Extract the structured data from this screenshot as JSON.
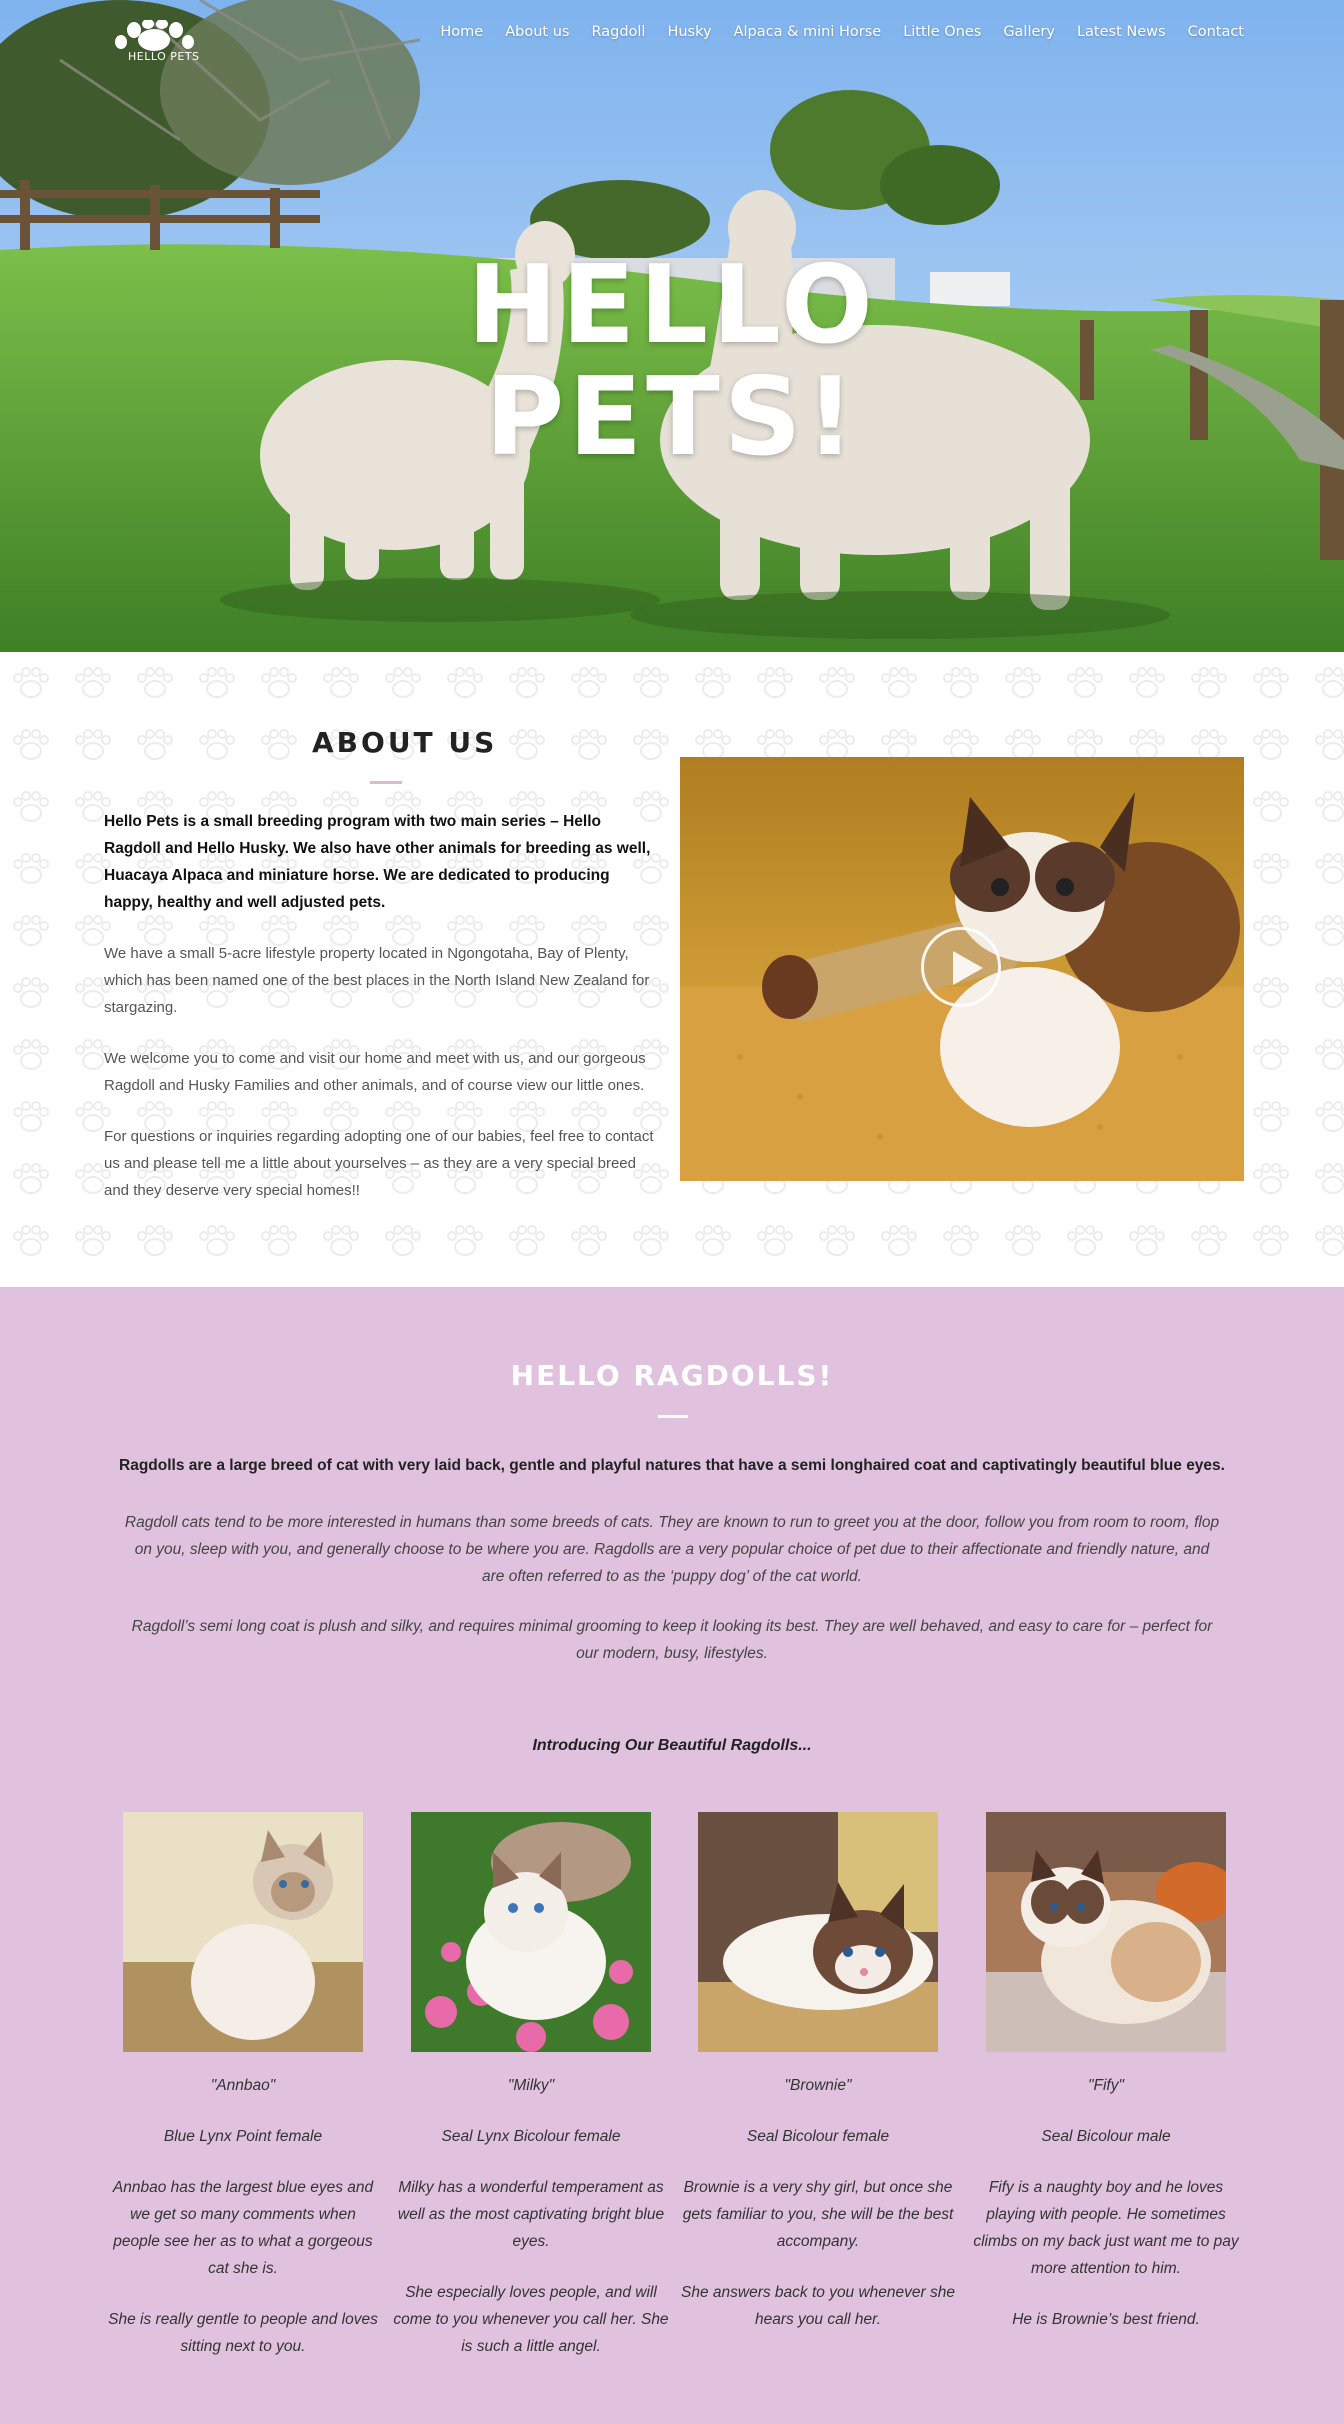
{
  "nav": {
    "logo_text": "HELLO PETS",
    "links": [
      "Home",
      "About us",
      "Ragdoll",
      "Husky",
      "Alpaca & mini Horse",
      "Little Ones",
      "Gallery",
      "Latest News",
      "Contact"
    ]
  },
  "hero": {
    "title_line1": "HELLO",
    "title_line2": "PETS!"
  },
  "about": {
    "title": "ABOUT US",
    "lead": "Hello Pets is a small breeding program with two main series – Hello Ragdoll and Hello Husky. We also have other animals for breeding as well, Huacaya Alpaca and miniature horse. We are dedicated to producing happy, healthy and well adjusted pets.",
    "para1": "We have a small 5-acre lifestyle property located in Ngongotaha, Bay of Plenty, which has been named one of the best places in the North Island New Zealand for stargazing.",
    "para2": "We welcome you to come and visit our home and meet with us, and our gorgeous Ragdoll and Husky Families and other animals, and of course view our little ones.",
    "para3": "For questions or inquiries regarding adopting one of our babies, feel free to contact us and please tell me a little about yourselves – as they are a very special breed and they deserve very special homes!!"
  },
  "ragdolls": {
    "title": "HELLO RAGDOLLS!",
    "lead": "Ragdolls are a large breed of cat with very laid back, gentle and playful natures that have a semi longhaired coat and captivatingly beautiful blue eyes.",
    "para1": "Ragdoll cats tend to be more interested in humans than some breeds of cats. They are known to run to greet you at the door, follow you from room to room, flop on you, sleep with you, and generally choose to be where you are. Ragdolls are a very popular choice of pet due to their affectionate and friendly nature, and are often referred to as the ‘puppy dog’ of the cat world.",
    "para2": "Ragdoll’s semi long coat is plush and silky, and requires minimal grooming to keep it looking its best. They are well behaved, and easy to care for – perfect for our modern, busy, lifestyles.",
    "intro": "Introducing Our Beautiful Ragdolls...",
    "cats": [
      {
        "name": "\"Annbao\"",
        "breed": "Blue Lynx Point female",
        "desc1": "Annbao has the largest blue eyes and we get so many comments when people see her as to what a gorgeous cat she is.",
        "desc2": "She is really gentle to people and loves sitting next to you."
      },
      {
        "name": "\"Milky\"",
        "breed": "Seal Lynx Bicolour female",
        "desc1": "Milky has a wonderful temperament as well as the most captivating bright blue eyes.",
        "desc2": "She especially loves people, and will come to you whenever you call her. She is such a little angel."
      },
      {
        "name": "\"Brownie\"",
        "breed": "Seal Bicolour female",
        "desc1": "Brownie is a very shy girl, but once she gets familiar to you, she will be the best accompany.",
        "desc2": "She answers back to you whenever she hears you call her."
      },
      {
        "name": "\"Fify\"",
        "breed": "Seal Bicolour male",
        "desc1": "Fify is a naughty boy and he loves playing with people. He sometimes climbs on my back just want me to pay more attention to him.",
        "desc2": "He is Brownie’s best friend."
      }
    ]
  },
  "colors": {
    "section_pink": "#e0c2de",
    "sky": "#8ebff0",
    "grass": "#5f9e3a"
  }
}
